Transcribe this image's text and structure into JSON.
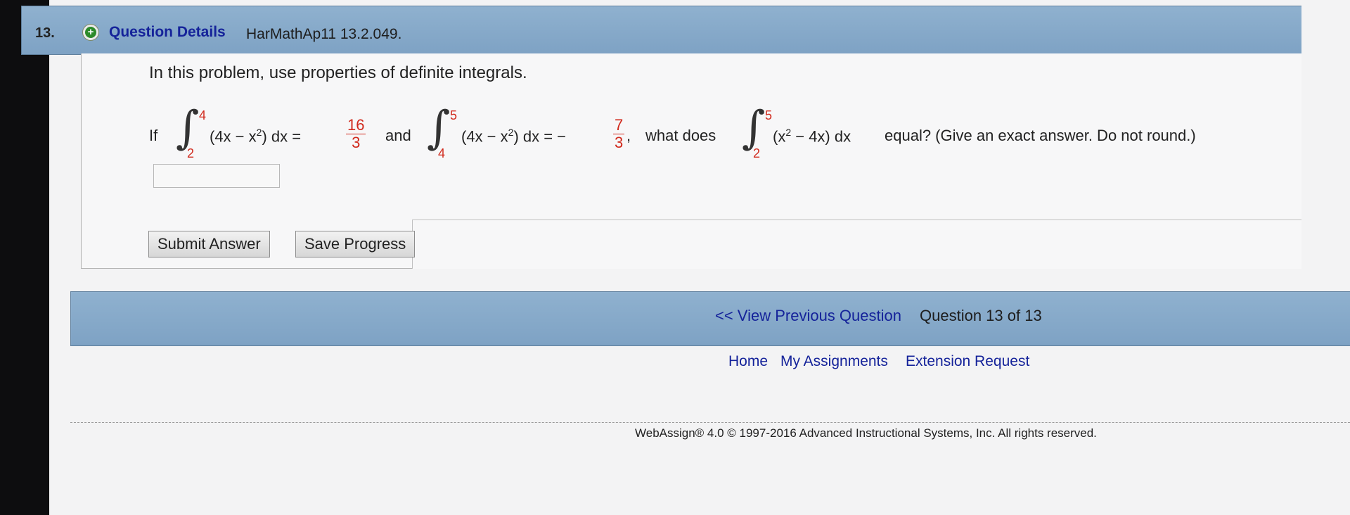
{
  "question": {
    "number": "13.",
    "details_label": "Question Details",
    "code": "HarMathAp11 13.2.049.",
    "intro": "In this problem, use properties of definite integrals.",
    "if_text": "If",
    "int1": {
      "upper": "4",
      "lower": "2",
      "integrand_a": "(4x − x",
      "sup": "2",
      "integrand_b": ") dx ="
    },
    "frac1": {
      "num": "16",
      "den": "3"
    },
    "and_text": "and",
    "int2": {
      "upper": "5",
      "lower": "4",
      "integrand_a": "(4x − x",
      "sup": "2",
      "integrand_b": ") dx = −"
    },
    "frac2": {
      "num": "7",
      "den": "3"
    },
    "comma": ",",
    "what_does": "what does",
    "int3": {
      "upper": "5",
      "lower": "2",
      "integrand_a": "(x",
      "sup": "2",
      "integrand_b": " − 4x) dx"
    },
    "ending": "equal? (Give an exact answer. Do not round.)",
    "answer_value": ""
  },
  "buttons": {
    "submit": "Submit Answer",
    "save": "Save Progress"
  },
  "nav": {
    "prev": "<< View Previous Question",
    "count": "Question 13 of 13"
  },
  "footer": {
    "home": "Home",
    "assignments": "My Assignments",
    "extension": "Extension Request",
    "copyright": "WebAssign® 4.0 © 1997-2016 Advanced Instructional Systems, Inc. All rights reserved."
  },
  "colors": {
    "band": "#8fb1cf",
    "link": "#15239a",
    "red": "#d12a1d"
  }
}
